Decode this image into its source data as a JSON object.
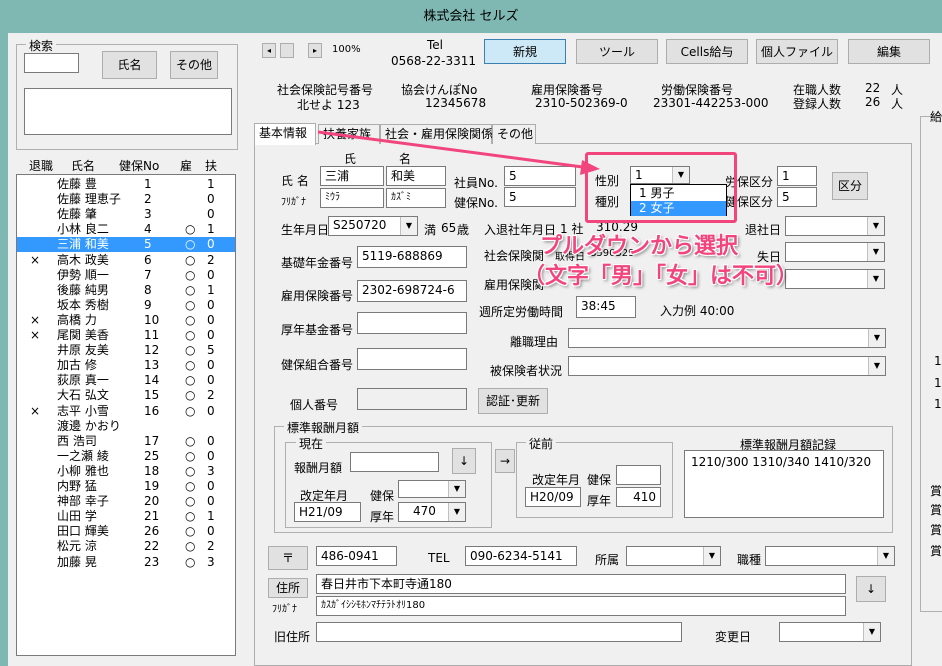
{
  "window": {
    "title": "株式会社 セルズ"
  },
  "search": {
    "label": "検索",
    "name_button": "氏名",
    "other_button": "その他"
  },
  "staff_list": {
    "headers": [
      "退職",
      "氏名",
      "健保No",
      "雇",
      "扶"
    ],
    "rows": [
      {
        "ret": "",
        "name": "佐藤 豊",
        "no": "1",
        "koyo": "",
        "fu": "1"
      },
      {
        "ret": "",
        "name": "佐藤 理恵子",
        "no": "2",
        "koyo": "",
        "fu": "0"
      },
      {
        "ret": "",
        "name": "佐藤 肇",
        "no": "3",
        "koyo": "",
        "fu": "0"
      },
      {
        "ret": "",
        "name": "小林 良二",
        "no": "4",
        "koyo": "○",
        "fu": "1"
      },
      {
        "ret": "",
        "name": "三浦 和美",
        "no": "5",
        "koyo": "○",
        "fu": "0"
      },
      {
        "ret": "×",
        "name": "高木 政美",
        "no": "6",
        "koyo": "○",
        "fu": "2"
      },
      {
        "ret": "",
        "name": "伊勢 順一",
        "no": "7",
        "koyo": "○",
        "fu": "0"
      },
      {
        "ret": "",
        "name": "後藤 純男",
        "no": "8",
        "koyo": "○",
        "fu": "1"
      },
      {
        "ret": "",
        "name": "坂本 秀樹",
        "no": "9",
        "koyo": "○",
        "fu": "0"
      },
      {
        "ret": "×",
        "name": "高橋 力",
        "no": "10",
        "koyo": "○",
        "fu": "0"
      },
      {
        "ret": "×",
        "name": "尾関 美香",
        "no": "11",
        "koyo": "○",
        "fu": "0"
      },
      {
        "ret": "",
        "name": "井原 友美",
        "no": "12",
        "koyo": "○",
        "fu": "5"
      },
      {
        "ret": "",
        "name": "加古 修",
        "no": "13",
        "koyo": "○",
        "fu": "0"
      },
      {
        "ret": "",
        "name": "荻原 真一",
        "no": "14",
        "koyo": "○",
        "fu": "0"
      },
      {
        "ret": "",
        "name": "大石 弘文",
        "no": "15",
        "koyo": "○",
        "fu": "2"
      },
      {
        "ret": "×",
        "name": "志平 小雪",
        "no": "16",
        "koyo": "○",
        "fu": "0"
      },
      {
        "ret": "",
        "name": "渡邊 かおり",
        "no": "",
        "koyo": "",
        "fu": ""
      },
      {
        "ret": "",
        "name": "西 浩司",
        "no": "17",
        "koyo": "○",
        "fu": "0"
      },
      {
        "ret": "",
        "name": "一之瀬 綾",
        "no": "25",
        "koyo": "○",
        "fu": "0"
      },
      {
        "ret": "",
        "name": "小柳 雅也",
        "no": "18",
        "koyo": "○",
        "fu": "3"
      },
      {
        "ret": "",
        "name": "内野 猛",
        "no": "19",
        "koyo": "○",
        "fu": "0"
      },
      {
        "ret": "",
        "name": "神部 幸子",
        "no": "20",
        "koyo": "○",
        "fu": "0"
      },
      {
        "ret": "",
        "name": "山田 学",
        "no": "21",
        "koyo": "○",
        "fu": "1"
      },
      {
        "ret": "",
        "name": "田口 輝美",
        "no": "26",
        "koyo": "○",
        "fu": "0"
      },
      {
        "ret": "",
        "name": "松元 涼",
        "no": "22",
        "koyo": "○",
        "fu": "2"
      },
      {
        "ret": "",
        "name": "加藤 晃",
        "no": "23",
        "koyo": "○",
        "fu": "3"
      }
    ],
    "selected_index": 4
  },
  "toolbar": {
    "zoom": "100%",
    "tel_label": "Tel",
    "tel_number": "0568-22-3311",
    "new_button": "新規",
    "tool_button": "ツール",
    "cells_button": "Cells給与",
    "personal_file_button": "個人ファイル",
    "edit_button": "編集"
  },
  "info": {
    "social_label": "社会保険記号番号",
    "social_value": "北せよ 123",
    "kyokai_label": "協会けんぽNo",
    "kyokai_value": "12345678",
    "koyo_label": "雇用保険番号",
    "koyo_value": "2310-502369-0",
    "rodo_label": "労働保険番号",
    "rodo_value": "23301-442253-000",
    "zaishoku_label": "在職人数",
    "zaishoku_value": "22",
    "toroku_label": "登録人数",
    "toroku_value": "26",
    "unit": "人"
  },
  "tabs": [
    "基本情報",
    "扶養家族",
    "社会・雇用保険関係",
    "その他"
  ],
  "form": {
    "sei_label": "氏",
    "mei_label": "名",
    "shimei_label": "氏 名",
    "furigana_label": "ﾌﾘｶﾞﾅ",
    "sei_value": "三浦",
    "mei_value": "和美",
    "sei_kana": "ﾐｳﾗ",
    "mei_kana": "ｶｽﾞﾐ",
    "shain_no_label": "社員No.",
    "shain_no_value": "5",
    "kenpo_no_label": "健保No.",
    "kenpo_no_value": "5",
    "seibetsu_label": "性別",
    "seibetsu_value": "1",
    "shubetsu_label": "種別",
    "rodo_kubun_label": "労保区分",
    "rodo_kubun_value": "1",
    "kenpo_kubun_label": "健保区分",
    "kenpo_kubun_value": "5",
    "kubun_button": "区分",
    "birth_label": "生年月日",
    "birth_value": "S250720",
    "age_prefix": "満",
    "age_value": "65",
    "age_unit": "歳",
    "join_label": "入退社年月日",
    "join_frag": "1 社",
    "join_frag2": "310.29",
    "taishabi_label": "退社日",
    "shaho_label": "社会保険関",
    "shaho_frag": "取得日",
    "shaho_frag2": "S590329",
    "soshitsu_label": "失日",
    "koyo_kan_label": "雇用保険関",
    "kiso_label": "基礎年金番号",
    "kiso_value": "5119-688869",
    "koyohoken_label": "雇用保険番号",
    "koyohoken_value": "2302-698724-6",
    "shotei_label": "週所定労働時間",
    "shotei_value": "38:45",
    "nyuryoku_label": "入力例 40:00",
    "kosei_label": "厚年基金番号",
    "rishoku_label": "離職理由",
    "kenpo_kumiai_label": "健保組合番号",
    "hihoken_label": "被保険者状況",
    "kojin_label": "個人番号",
    "ninsho_button": "認証･更新",
    "std_group": "標準報酬月額",
    "genzai_group": "現在",
    "houshu_label": "報酬月額",
    "down_arrow_button": "↓",
    "kaitei_label": "改定年月",
    "kaitei_value": "H21/09",
    "kenpo_label": "健保",
    "konen_label": "厚年",
    "konen_value": "470",
    "juzen_group": "従前",
    "right_arrow_button": "→",
    "kaitei2_label": "改定年月",
    "kaitei2_value": "H20/09",
    "kenpo2_label": "健保",
    "konen2_label": "厚年",
    "konen2_value": "410",
    "record_label": "標準報酬月額記録",
    "record_value": "1210/300 1310/340 1410/320",
    "postal_button": "〒",
    "postal_value": "486-0941",
    "tel_label": "TEL",
    "tel_value": "090-6234-5141",
    "shozoku_label": "所属",
    "shokushu_label": "職種",
    "address_button": "住所",
    "address_value": "春日井市下本町寺通180",
    "address_kana_label": "ﾌﾘｶﾞﾅ",
    "address_kana_value": "ｶｽｶﾞｲｼｼﾓﾎﾝﾏﾁﾃﾗﾄｵﾘ180",
    "address_down_button": "↓",
    "kyu_jusho_label": "旧住所",
    "henko_label": "変更日"
  },
  "gender_dropdown": {
    "options": [
      "1  男子",
      "2  女子"
    ],
    "selected_index": 1
  },
  "annotation": {
    "line1": "プルダウンから選択",
    "line2": "（文字「男」「女」は不可）"
  },
  "right_edge": {
    "tab_frag": "給",
    "num1": "1",
    "num2": "1",
    "num3": "1",
    "kanji1": "賞",
    "kanji2": "賞",
    "kanji3": "賞",
    "kanji4": "賞"
  },
  "colors": {
    "window_bg": "#7fb8b2",
    "accent_pink": "#f2457e",
    "selection": "#3399ff",
    "new_button": "#cde8f7"
  }
}
